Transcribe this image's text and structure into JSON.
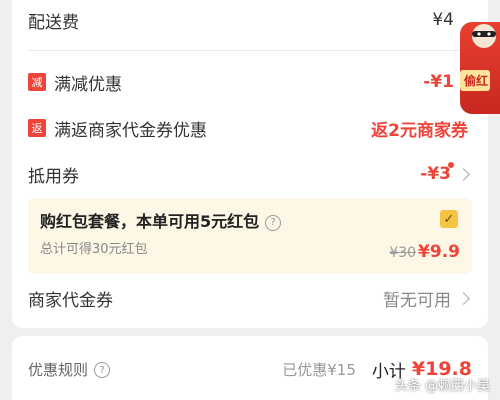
{
  "rows": {
    "delivery": {
      "label": "配送费",
      "value": "¥4"
    },
    "discount": {
      "tag": "减",
      "label": "满减优惠",
      "value": "-¥1"
    },
    "rebate": {
      "tag": "返",
      "label": "满返商家代金券优惠",
      "value": "返2元商家券"
    },
    "coupon": {
      "label": "抵用券",
      "value": "-¥3"
    },
    "merchant_voucher": {
      "label": "商家代金券",
      "value": "暂无可用"
    }
  },
  "package": {
    "title": "购红包套餐，本单可用5元红包",
    "help_icon": "?",
    "subtitle": "总计可得30元红包",
    "original_price": "¥30",
    "price": "¥9.9",
    "checkbox": "✓",
    "checked": true
  },
  "footer": {
    "rule_label": "优惠规则",
    "help_icon": "?",
    "saved": "已优惠¥15",
    "subtotal_label": "小计",
    "subtotal_value": "¥19.8"
  },
  "badge": {
    "label": "偷红"
  },
  "watermark": "头条 @赖西小吴",
  "colors": {
    "accent": "#f0433a",
    "package_bg": "#fdf7e6",
    "checkbox": "#f6c445"
  }
}
